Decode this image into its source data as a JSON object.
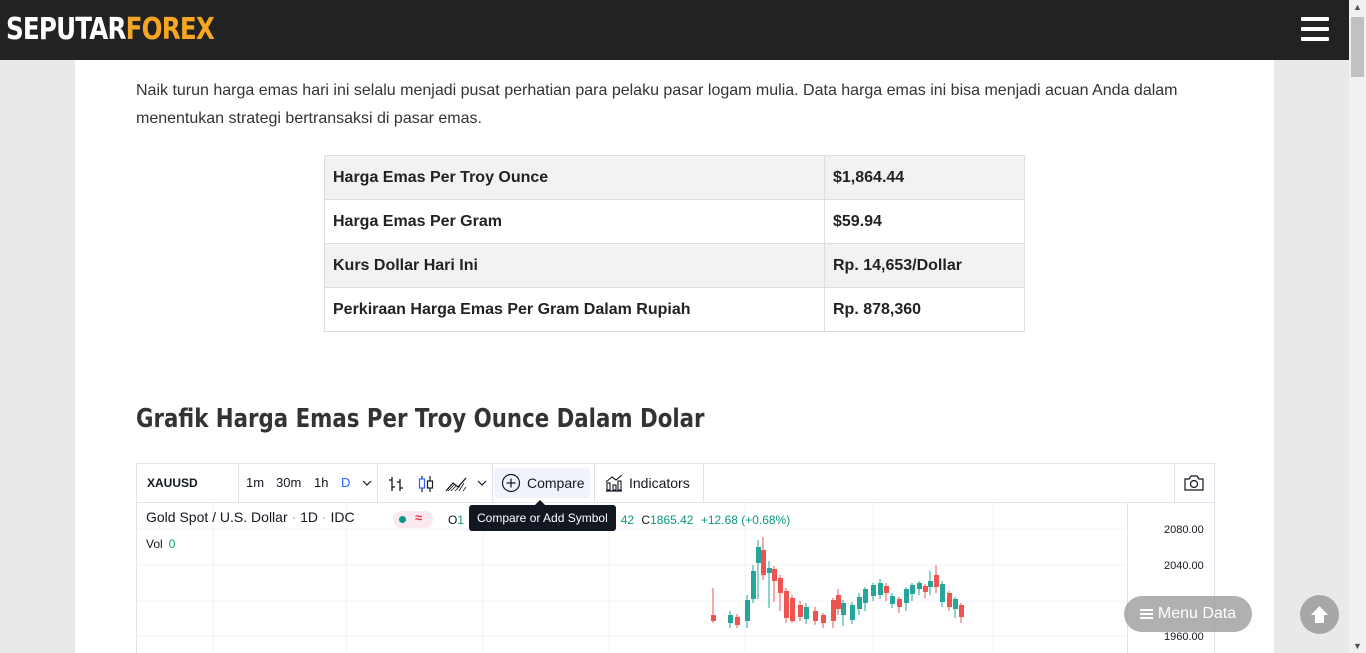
{
  "header": {
    "logo_part1": "SEPUTAR",
    "logo_part2": "FOREX",
    "menu_icon": "hamburger-icon",
    "logo_accent_color": "#f5a623"
  },
  "intro_text": "Naik turun harga emas hari ini selalu menjadi pusat perhatian para pelaku pasar logam mulia. Data harga emas ini bisa menjadi acuan Anda dalam menentukan strategi bertransaksi di pasar emas.",
  "price_table": [
    {
      "label": "Harga Emas Per Troy Ounce",
      "value": "$1,864.44"
    },
    {
      "label": "Harga Emas Per Gram",
      "value": "$59.94"
    },
    {
      "label": "Kurs Dollar Hari Ini",
      "value": "Rp. 14,653/Dollar"
    },
    {
      "label": "Perkiraan Harga Emas Per Gram Dalam Rupiah",
      "value": "Rp. 878,360"
    }
  ],
  "section_title": "Grafik Harga Emas Per Troy Ounce Dalam Dolar",
  "widget": {
    "symbol": "XAUUSD",
    "timeframes": [
      "1m",
      "30m",
      "1h",
      "D"
    ],
    "active_timeframe": "D",
    "compare_label": "Compare",
    "indicators_label": "Indicators",
    "tooltip": "Compare or Add Symbol",
    "legend_title": "Gold Spot / U.S. Dollar",
    "legend_interval": "1D",
    "legend_source": "IDC",
    "ohlc_open_key": "O",
    "ohlc_open_partial": "1",
    "ohlc_mid_partial": "42",
    "ohlc_close_key": "C",
    "ohlc_close": "1865.42",
    "ohlc_change": "+12.68 (+0.68%)",
    "vol_label": "Vol",
    "vol_value": "0",
    "price_axis": [
      "2080.00",
      "2040.00",
      "1960.00"
    ],
    "up_color": "#26a69a",
    "down_color": "#ef5350"
  },
  "floating": {
    "menu_data_label": "Menu Data"
  }
}
